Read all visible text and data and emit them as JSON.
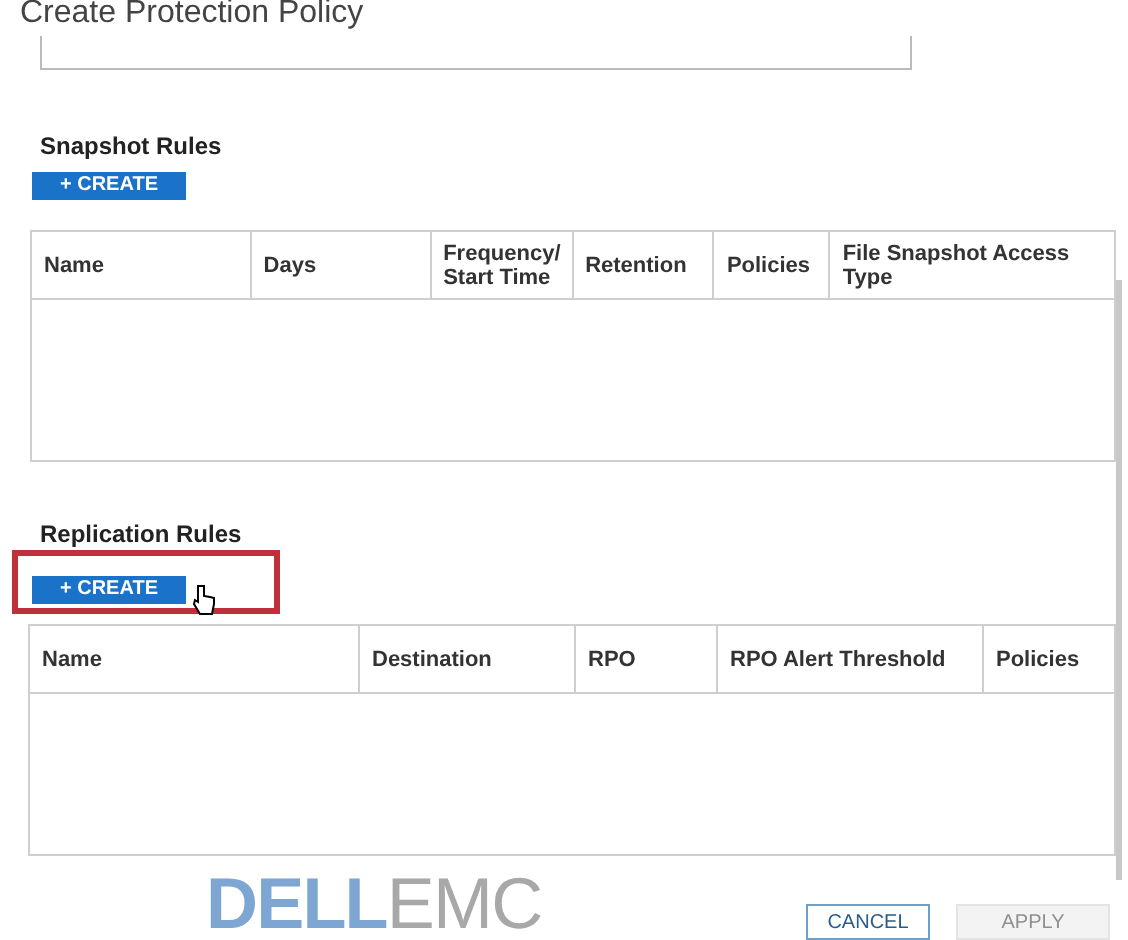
{
  "window": {
    "title": "Create Protection Policy"
  },
  "snapshot_rules": {
    "title": "Snapshot Rules",
    "create_button": "+ CREATE",
    "columns": [
      "Name",
      "Days",
      "Frequency/ Start Time",
      "Retention",
      "Policies",
      "File Snapshot Access Type"
    ]
  },
  "replication_rules": {
    "title": "Replication Rules",
    "create_button": "+ CREATE",
    "highlighted": true,
    "columns": [
      "Name",
      "Destination",
      "RPO",
      "RPO Alert Threshold",
      "Policies"
    ]
  },
  "logo": {
    "brand": "DELL",
    "suffix": "EMC"
  },
  "buttons": [
    {
      "label": "CANCEL",
      "disabled": false
    },
    {
      "label": "APPLY",
      "disabled": true
    }
  ]
}
